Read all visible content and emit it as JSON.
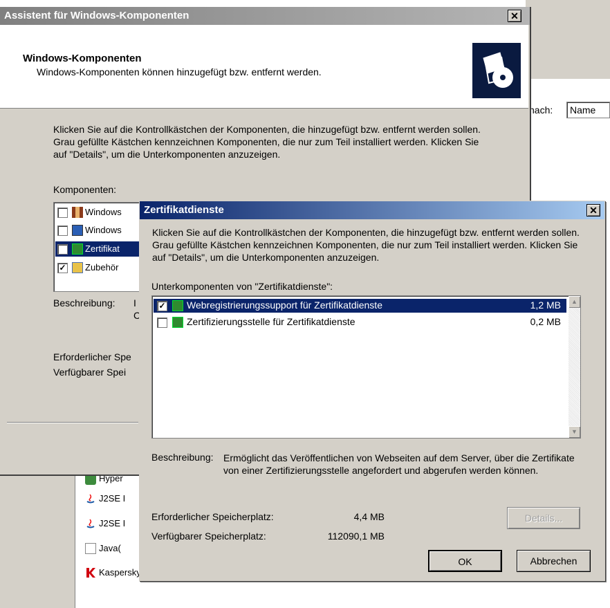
{
  "background": {
    "search_label": "nach:",
    "search_value": "Name",
    "list_items": [
      "Hyper",
      "J2SE I",
      "J2SE I",
      "Java(",
      "Kaspersky Administration Kit"
    ]
  },
  "wizard": {
    "title": "Assistent für Windows-Komponenten",
    "close": "✕",
    "header_title": "Windows-Komponenten",
    "header_subtitle": "Windows-Komponenten können hinzugefügt bzw. entfernt werden.",
    "instructions": "Klicken Sie auf die Kontrollkästchen der Komponenten, die hinzugefügt bzw. entfernt werden sollen. Grau gefüllte Kästchen kennzeichnen Komponenten, die nur zum Teil installiert werden. Klicken Sie auf \"Details\", um die Unterkomponenten anzuzeigen.",
    "components_label": "Komponenten:",
    "components": [
      {
        "label": "Windows",
        "checked": false
      },
      {
        "label": "Windows",
        "checked": false
      },
      {
        "label": "Zertifikat",
        "checked": true,
        "selected": true
      },
      {
        "label": "Zubehör",
        "checked": true
      }
    ],
    "description_label": "Beschreibung:",
    "description_frag1": "I",
    "description_frag2": "C",
    "required_label": "Erforderlicher Spe",
    "available_label": "Verfügbarer Spei"
  },
  "sub": {
    "title": "Zertifikatdienste",
    "close": "✕",
    "instructions": "Klicken Sie auf die Kontrollkästchen der Komponenten, die hinzugefügt bzw. entfernt werden sollen. Grau gefüllte Kästchen kennzeichnen Komponenten, die nur zum Teil installiert werden. Klicken Sie auf \"Details\", um die Unterkomponenten anzuzeigen.",
    "list_label": "Unterkomponenten von \"Zertifikatdienste\":",
    "items": [
      {
        "label": "Webregistrierungssupport für Zertifikatdienste",
        "size": "1,2 MB",
        "checked": true,
        "selected": true
      },
      {
        "label": "Zertifizierungsstelle für Zertifikatdienste",
        "size": "0,2 MB",
        "checked": false
      }
    ],
    "description_label": "Beschreibung:",
    "description": "Ermöglicht das Veröffentlichen von Webseiten auf dem Server, über die Zertifikate von einer Zertifizierungsstelle angefordert und abgerufen werden können.",
    "required_label": "Erforderlicher Speicherplatz:",
    "required_value": "4,4 MB",
    "available_label": "Verfügbarer Speicherplatz:",
    "available_value": "112090,1 MB",
    "details_button": "Details...",
    "ok_button": "OK",
    "cancel_button": "Abbrechen"
  },
  "colors": {
    "active_title": "#0a246a",
    "inactive_title": "#808080",
    "selection": "#0a246a",
    "face": "#d4d0c8"
  }
}
